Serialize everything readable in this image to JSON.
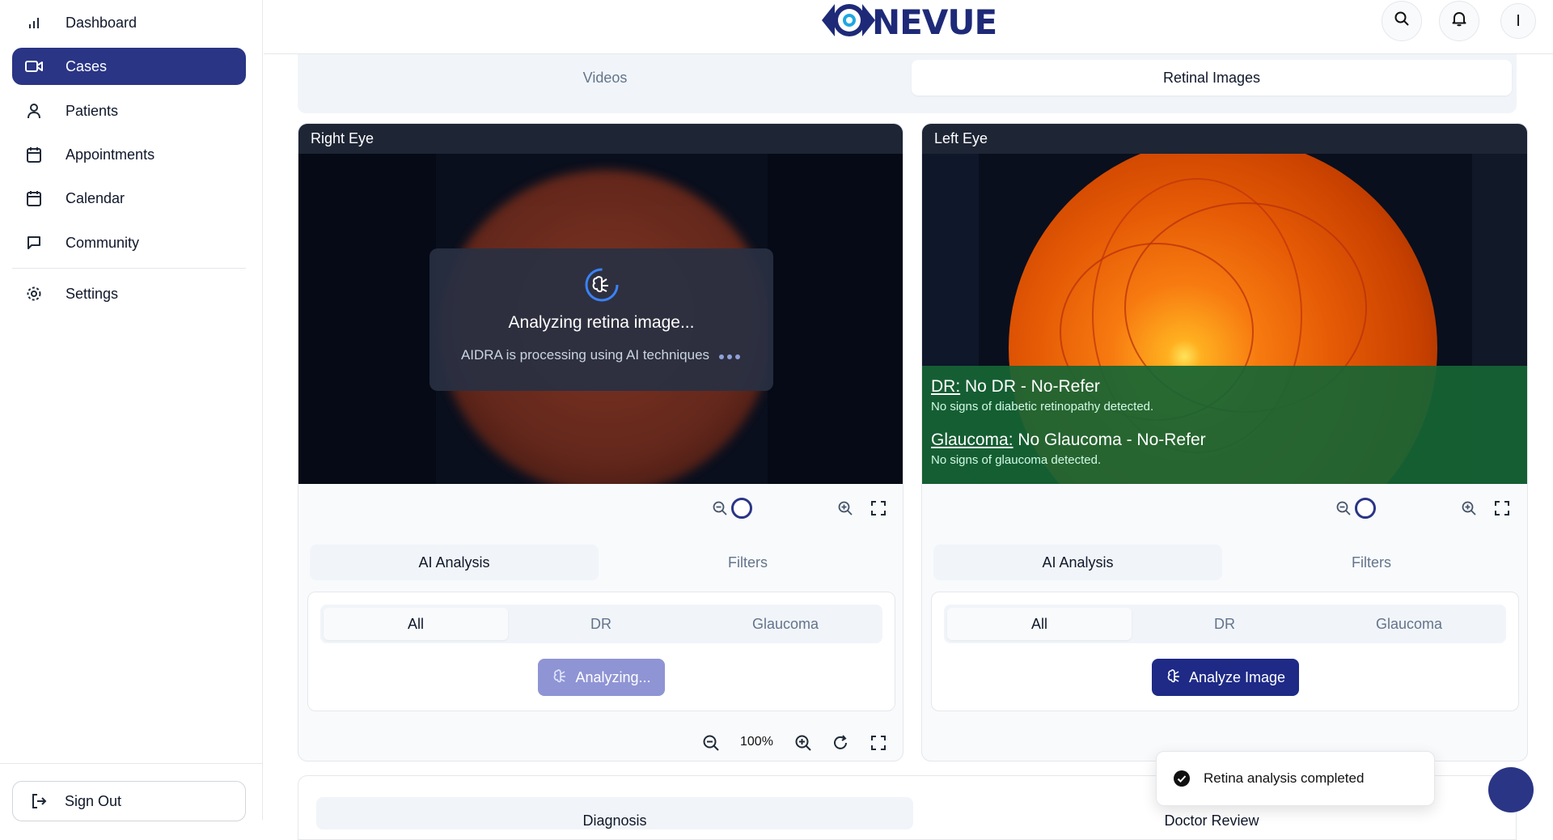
{
  "sidebar": {
    "items": [
      {
        "label": "Dashboard",
        "icon": "bar-chart-icon"
      },
      {
        "label": "Cases",
        "icon": "video-icon",
        "active": true
      },
      {
        "label": "Patients",
        "icon": "user-icon"
      },
      {
        "label": "Appointments",
        "icon": "calendar-icon"
      },
      {
        "label": "Calendar",
        "icon": "calendar-icon"
      },
      {
        "label": "Community",
        "icon": "chat-icon"
      }
    ],
    "settings_label": "Settings",
    "signout_label": "Sign Out"
  },
  "header": {
    "logo_text": "NEVUE",
    "profile_initial": "I"
  },
  "media_tabs": [
    {
      "label": "Videos",
      "active": false
    },
    {
      "label": "Retinal Images",
      "active": true
    }
  ],
  "right_eye": {
    "title": "Right Eye",
    "analyzing_title": "Analyzing retina image...",
    "analyzing_sub": "AIDRA is processing using AI techniques",
    "sub_tabs": [
      "AI Analysis",
      "Filters"
    ],
    "filters": [
      "All",
      "DR",
      "Glaucoma"
    ],
    "action_label": "Analyzing...",
    "zoom_pct": "100%"
  },
  "left_eye": {
    "title": "Left Eye",
    "dr_label": "DR:",
    "dr_value": " No DR - No-Refer",
    "dr_desc": "No signs of diabetic retinopathy detected.",
    "glaucoma_label": "Glaucoma:",
    "glaucoma_value": " No Glaucoma - No-Refer",
    "glaucoma_desc": "No signs of glaucoma detected.",
    "sub_tabs": [
      "AI Analysis",
      "Filters"
    ],
    "filters": [
      "All",
      "DR",
      "Glaucoma"
    ],
    "action_label": "Analyze Image"
  },
  "bottom_tabs": [
    "Diagnosis",
    "Doctor Review"
  ],
  "toast": {
    "message": "Retina analysis completed"
  },
  "colors": {
    "accent": "#2a3585",
    "success_overlay": "#166534",
    "disabled_button": "#8f94d4"
  }
}
